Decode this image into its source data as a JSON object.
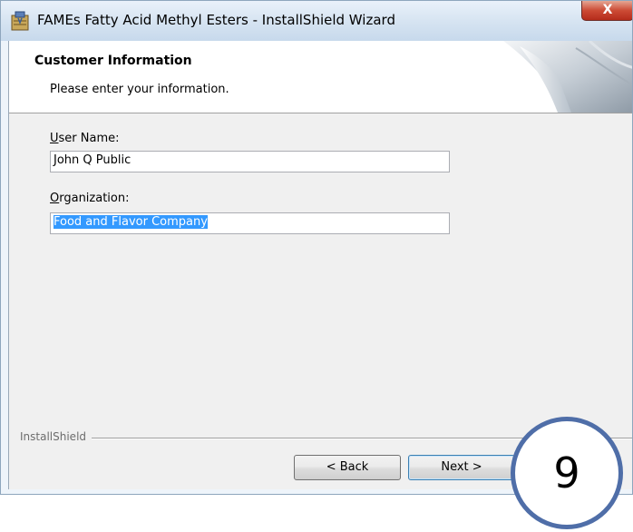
{
  "window": {
    "title": "FAMEs Fatty Acid Methyl Esters - InstallShield Wizard",
    "close_glyph": "X",
    "icon": "installer-package-icon"
  },
  "header": {
    "title": "Customer Information",
    "subtitle": "Please enter your information."
  },
  "form": {
    "username": {
      "label_accel": "U",
      "label_rest": "ser Name:",
      "value": "John Q Public"
    },
    "organization": {
      "label_accel": "O",
      "label_rest": "rganization:",
      "value": "Food and Flavor Company"
    }
  },
  "footer": {
    "brand": "InstallShield",
    "back_label": "< Back",
    "next_label": "Next >"
  },
  "badge": {
    "number": "9"
  },
  "colors": {
    "selection": "#3399ff",
    "close_button": "#cc4b35",
    "badge_ring": "#4f6ea8"
  }
}
